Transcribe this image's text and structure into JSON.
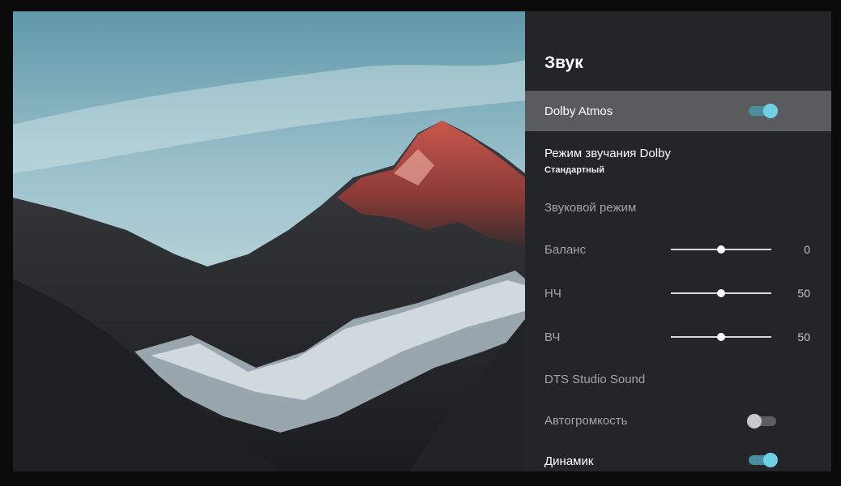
{
  "panel": {
    "title": "Звук",
    "items": [
      {
        "label": "Dolby Atmos",
        "type": "toggle",
        "state": "on",
        "active": true
      },
      {
        "label": "Режим звучания Dolby",
        "sublabel": "Стандартный",
        "type": "select"
      },
      {
        "label": "Звуковой режим",
        "type": "disabled"
      },
      {
        "label": "Баланс",
        "type": "slider",
        "value": "0",
        "level": 0.5
      },
      {
        "label": "НЧ",
        "type": "slider",
        "value": "50",
        "level": 0.5
      },
      {
        "label": "ВЧ",
        "type": "slider",
        "value": "50",
        "level": 0.5
      },
      {
        "label": "DTS Studio Sound",
        "type": "disabled"
      },
      {
        "label": "Автогромкость",
        "type": "toggle",
        "state": "off"
      },
      {
        "label": "Динамик",
        "type": "toggle",
        "state": "on"
      }
    ]
  },
  "colors": {
    "panel_bg": "#242528",
    "active_row": "#5a5b5d",
    "toggle_on": "#6fd0e6"
  }
}
